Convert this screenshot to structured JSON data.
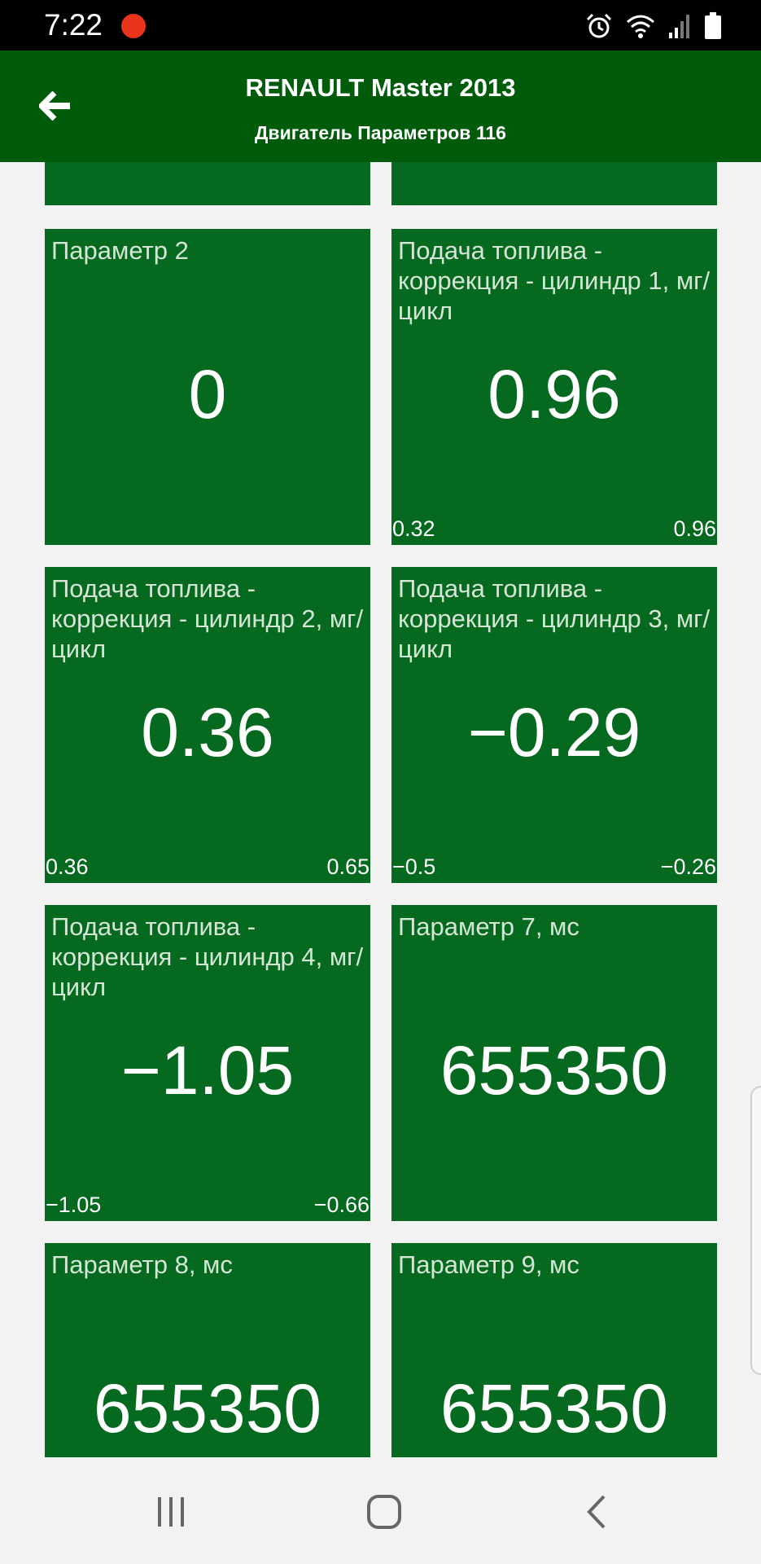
{
  "status": {
    "time": "7:22"
  },
  "header": {
    "title": "RENAULT Master 2013",
    "subtitle": "Двигатель Параметров 116"
  },
  "tiles": [
    {
      "label": "",
      "value": "",
      "min": "",
      "max": ""
    },
    {
      "label": "",
      "value": "",
      "min": "",
      "max": ""
    },
    {
      "label": "Параметр 2",
      "value": "0",
      "min": "",
      "max": ""
    },
    {
      "label": "Подача топлива - коррекция - цилиндр 1, мг/цикл",
      "value": "0.96",
      "min": "0.32",
      "max": "0.96"
    },
    {
      "label": "Подача топлива - коррекция - цилиндр 2, мг/цикл",
      "value": "0.36",
      "min": "0.36",
      "max": "0.65"
    },
    {
      "label": "Подача топлива - коррекция - цилиндр 3, мг/цикл",
      "value": "−0.29",
      "min": "−0.5",
      "max": "−0.26"
    },
    {
      "label": "Подача топлива - коррекция - цилиндр 4, мг/цикл",
      "value": "−1.05",
      "min": "−1.05",
      "max": "−0.66"
    },
    {
      "label": "Параметр 7, мс",
      "value": "655350",
      "min": "",
      "max": ""
    },
    {
      "label": "Параметр 8, мс",
      "value": "655350",
      "min": "",
      "max": ""
    },
    {
      "label": "Параметр 9, мс",
      "value": "655350",
      "min": "",
      "max": ""
    }
  ],
  "icons": {
    "back": "arrow-left-icon",
    "alarm": "alarm-icon",
    "wifi": "wifi-icon",
    "signal": "signal-icon",
    "battery": "battery-icon",
    "recents": "recents-icon",
    "home": "home-icon",
    "nav_back": "chevron-left-icon"
  },
  "colors": {
    "app_bar": "#005c0a",
    "tile": "#05691f",
    "background": "#f2f2f2",
    "record_dot": "#e8341c"
  }
}
